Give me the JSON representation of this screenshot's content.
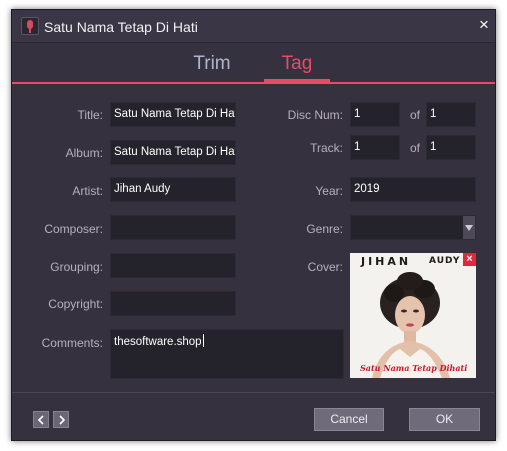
{
  "window": {
    "title": "Satu Nama Tetap Di Hati",
    "close_icon": "×"
  },
  "tabs": [
    {
      "label": "Trim",
      "active": false
    },
    {
      "label": "Tag",
      "active": true
    }
  ],
  "accent_color": "#e84b68",
  "fields": {
    "title": {
      "label": "Title:",
      "value": "Satu Nama Tetap Di Hati"
    },
    "album": {
      "label": "Album:",
      "value": "Satu Nama Tetap Di Hati"
    },
    "artist": {
      "label": "Artist:",
      "value": "Jihan Audy"
    },
    "composer": {
      "label": "Composer:",
      "value": ""
    },
    "grouping": {
      "label": "Grouping:",
      "value": ""
    },
    "copyright": {
      "label": "Copyright:",
      "value": ""
    },
    "comments": {
      "label": "Comments:",
      "value": "thesoftware.shop"
    },
    "disc_num": {
      "label": "Disc Num:",
      "value": "1",
      "of_label": "of",
      "total": "1"
    },
    "track": {
      "label": "Track:",
      "value": "1",
      "of_label": "of",
      "total": "1"
    },
    "year": {
      "label": "Year:",
      "value": "2019"
    },
    "genre": {
      "label": "Genre:",
      "value": ""
    },
    "cover": {
      "label": "Cover:",
      "remove_icon": "×",
      "art_text_left": "JIHAN",
      "art_text_right": "AUDY",
      "art_caption": "Satu Nama Tetap Dihati"
    }
  },
  "footer": {
    "prev_icon": "chevron-left",
    "next_icon": "chevron-right",
    "cancel_label": "Cancel",
    "ok_label": "OK"
  }
}
